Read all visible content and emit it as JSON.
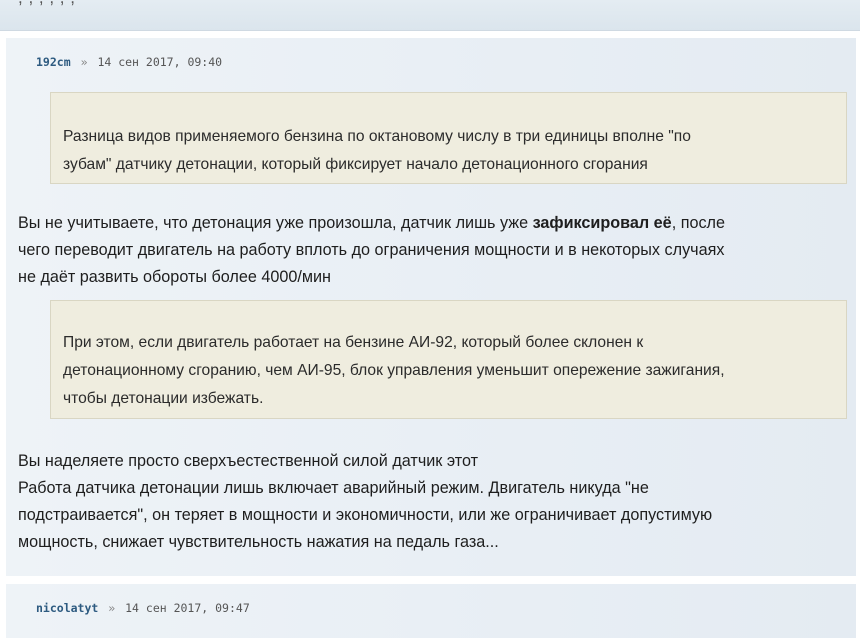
{
  "previous_post": {
    "cut_text": ", , , , , ,"
  },
  "posts": [
    {
      "author": "192cm",
      "separator": "»",
      "timestamp": "14 сен 2017, 09:40",
      "quote_1": [
        "Разница видов применяемого бензина по октановому числу в три единицы вполне \"по",
        "зубам\" датчику детонации, который фиксирует начало детонационного сгорания"
      ],
      "reply_1": {
        "line1_before": "Вы не учитываете, что детонация уже произошла, датчик лишь уже ",
        "line1_bold": "зафиксировал её",
        "line1_after": ", после",
        "line2": "чего переводит двигатель на работу вплоть до ограничения мощности и в некоторых случаях",
        "line3": "не даёт развить обороты более 4000/мин"
      },
      "quote_2": [
        "При этом, если двигатель работает на бензине АИ-92, который более склонен к",
        "детонационному сгоранию, чем АИ-95, блок управления уменьшит опережение зажигания,",
        "чтобы детонации избежать."
      ],
      "reply_2": [
        "Вы наделяете просто сверхъестественной силой датчик этот",
        "Работа датчика детонации лишь включает аварийный режим. Двигатель никуда \"не",
        "подстраивается\", он теряет в мощности и экономичности, или же ограничивает допустимую",
        "мощность, снижает чувствительность нажатия на педаль газа..."
      ]
    },
    {
      "author": "nicolatyt",
      "separator": "»",
      "timestamp": "14 сен 2017, 09:47"
    }
  ]
}
